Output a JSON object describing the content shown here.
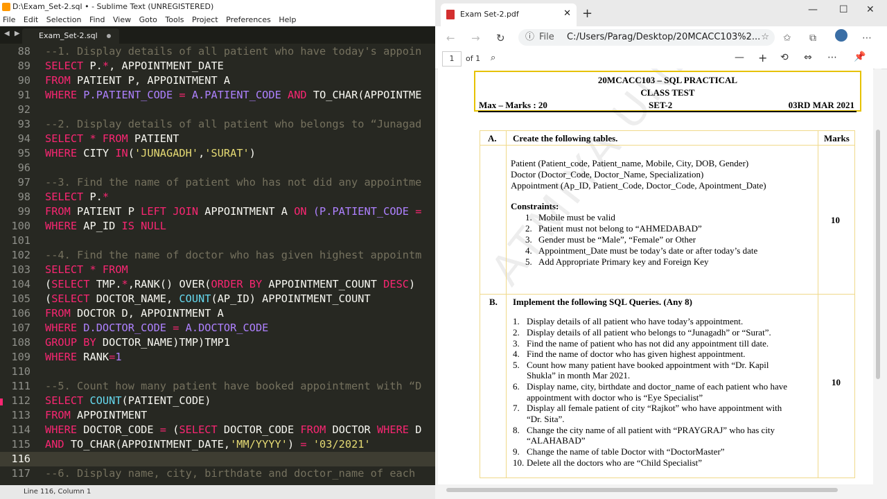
{
  "sublime": {
    "title": "D:\\Exam_Set-2.sql • - Sublime Text (UNREGISTERED)",
    "menu": [
      "File",
      "Edit",
      "Selection",
      "Find",
      "View",
      "Goto",
      "Tools",
      "Project",
      "Preferences",
      "Help"
    ],
    "tab_label": "Exam_Set-2.sql",
    "status": "Line 116, Column 1",
    "lines": [
      {
        "n": "88"
      },
      {
        "n": "89"
      },
      {
        "n": "90"
      },
      {
        "n": "91"
      },
      {
        "n": "92"
      },
      {
        "n": "93"
      },
      {
        "n": "94"
      },
      {
        "n": "95"
      },
      {
        "n": "96"
      },
      {
        "n": "97"
      },
      {
        "n": "98"
      },
      {
        "n": "99"
      },
      {
        "n": "100"
      },
      {
        "n": "101"
      },
      {
        "n": "102"
      },
      {
        "n": "103"
      },
      {
        "n": "104"
      },
      {
        "n": "105"
      },
      {
        "n": "106"
      },
      {
        "n": "107"
      },
      {
        "n": "108"
      },
      {
        "n": "109"
      },
      {
        "n": "110"
      },
      {
        "n": "111"
      },
      {
        "n": "112"
      },
      {
        "n": "113"
      },
      {
        "n": "114"
      },
      {
        "n": "115"
      },
      {
        "n": "116"
      },
      {
        "n": "117"
      }
    ],
    "code": {
      "l88": "--1. Display details of all patient who have today's appoin",
      "l89a": "SELECT",
      "l89b": " P.",
      "l89c": "*",
      "l89d": ", APPOINTMENT_DATE",
      "l90a": "FROM",
      "l90b": " PATIENT P, APPOINTMENT A",
      "l91a": "WHERE",
      "l91b": " P.",
      "l91c": "PATIENT_CODE",
      "l91d": " = ",
      "l91e": "A.",
      "l91f": "PATIENT_CODE",
      "l91g": " AND ",
      "l91h": "TO_CHAR(APPOINTME",
      "l93": "--2. Display details of all patient who belongs to “Junagad",
      "l94a": "SELECT",
      "l94b": " * ",
      "l94c": "FROM",
      "l94d": " PATIENT",
      "l95a": "WHERE",
      "l95b": " CITY ",
      "l95c": "IN",
      "l95d": "(",
      "l95e": "'JUNAGADH'",
      "l95f": ",",
      "l95g": "'SURAT'",
      "l95h": ")",
      "l97": "--3. Find the name of patient who has not did any appointme",
      "l98a": "SELECT",
      "l98b": " P.",
      "l98c": "*",
      "l99a": "FROM",
      "l99b": " PATIENT P ",
      "l99c": "LEFT JOIN",
      "l99d": " APPOINTMENT A ",
      "l99e": "ON",
      "l99f": " (P.",
      "l99g": "PATIENT_CODE",
      "l99h": " =",
      "l100a": "WHERE",
      "l100b": " AP_ID ",
      "l100c": "IS",
      "l100d": " ",
      "l100e": "NULL",
      "l102": "--4. Find the name of doctor who has given highest appointm",
      "l103a": "SELECT",
      "l103b": " * ",
      "l103c": "FROM",
      "l104a": "(",
      "l104b": "SELECT",
      "l104c": " TMP.",
      "l104d": "*",
      "l104e": ",RANK() OVER(",
      "l104f": "ORDER BY",
      "l104g": " APPOINTMENT_COUNT ",
      "l104h": "DESC",
      "l104i": ")",
      "l105a": "(",
      "l105b": "SELECT",
      "l105c": " DOCTOR_NAME, ",
      "l105d": "COUNT",
      "l105e": "(AP_ID) APPOINTMENT_COUNT",
      "l106a": "FROM",
      "l106b": " DOCTOR D, APPOINTMENT A",
      "l107a": "WHERE",
      "l107b": " D.",
      "l107c": "DOCTOR_CODE",
      "l107d": " = ",
      "l107e": "A.",
      "l107f": "DOCTOR_CODE",
      "l108a": "GROUP BY",
      "l108b": " DOCTOR_NAME)TMP)TMP1",
      "l109a": "WHERE",
      "l109b": " RANK",
      "l109c": "=",
      "l109d": "1",
      "l111": "--5. Count how many patient have booked appointment with “D",
      "l112a": "SELECT",
      "l112b": " ",
      "l112c": "COUNT",
      "l112d": "(PATIENT_CODE)",
      "l113a": "FROM",
      "l113b": " APPOINTMENT",
      "l114a": "WHERE",
      "l114b": " DOCTOR_CODE ",
      "l114c": "=",
      "l114d": " (",
      "l114e": "SELECT",
      "l114f": " DOCTOR_CODE ",
      "l114g": "FROM",
      "l114h": " DOCTOR ",
      "l114i": "WHERE",
      "l114j": " D",
      "l115a": "AND",
      "l115b": " TO_CHAR(APPOINTMENT_DATE,",
      "l115c": "'MM/YYYY'",
      "l115d": ") ",
      "l115e": "=",
      "l115f": " ",
      "l115g": "'03/2021'",
      "l117": "--6. Display name, city, birthdate and doctor_name of each"
    }
  },
  "browser": {
    "tab_title": "Exam Set-2.pdf",
    "url_label": "File",
    "url": "C:/Users/Parag/Desktop/20MCACC103%2...",
    "page_input": "1",
    "page_total": "of 1"
  },
  "pdf": {
    "header_title": "20MCACC103 – SQL PRACTICAL",
    "header_sub": "CLASS TEST",
    "max_marks": "Max – Marks : 20",
    "set": "SET-2",
    "date": "03RD MAR 2021",
    "col_a": "A.",
    "col_a_title": "Create the following tables.",
    "col_marks": "Marks",
    "tables": [
      "Patient (Patient_code, Patient_name, Mobile, City, DOB, Gender)",
      "Doctor (Doctor_Code, Doctor_Name, Specialization)",
      "Appointment (Ap_ID, Patient_Code, Doctor_Code, Apointment_Date)"
    ],
    "constraints_title": "Constraints:",
    "constraints": [
      "Mobile must be valid",
      "Patient must not belong to “AHMEDABAD”",
      "Gender must be “Male”, “Female” or Other",
      "Appointment_Date must be today’s date or after today’s date",
      "Add Appropriate Primary key and Foreign Key"
    ],
    "marks_a": "10",
    "col_b": "B.",
    "col_b_title": "Implement the following SQL Queries.  (Any 8)",
    "queries": [
      "Display details of all patient who have today’s appointment.",
      "Display details of all patient who belongs to “Junagadh” or “Surat”.",
      "Find the name of patient who has not did any appointment till date.",
      "Find the name of doctor who has given highest appointment.",
      "Count how many patient have booked appointment with “Dr. Kapil",
      "Shukla” in month Mar 2021.",
      "Display name, city, birthdate and doctor_name of each patient who have",
      "appointment with doctor who is “Eye Specialist”",
      "Display all female patient of city “Rajkot” who have appointment with",
      "“Dr. Sita”.",
      "Change the city name of all patient with “PRAYGRAJ” who has city",
      "“ALAHABAD”",
      "Change the name of table Doctor with “DoctorMaster”",
      "Delete all the doctors who are “Child Specialist”"
    ],
    "query_nums": [
      "1.",
      "2.",
      "3.",
      "4.",
      "5.",
      "6.",
      "7.",
      "8.",
      "9.",
      "10."
    ],
    "constraint_nums": [
      "1.",
      "2.",
      "3.",
      "4.",
      "5."
    ],
    "marks_b": "10",
    "watermark": "ATMIYA UNIVERSITY"
  }
}
